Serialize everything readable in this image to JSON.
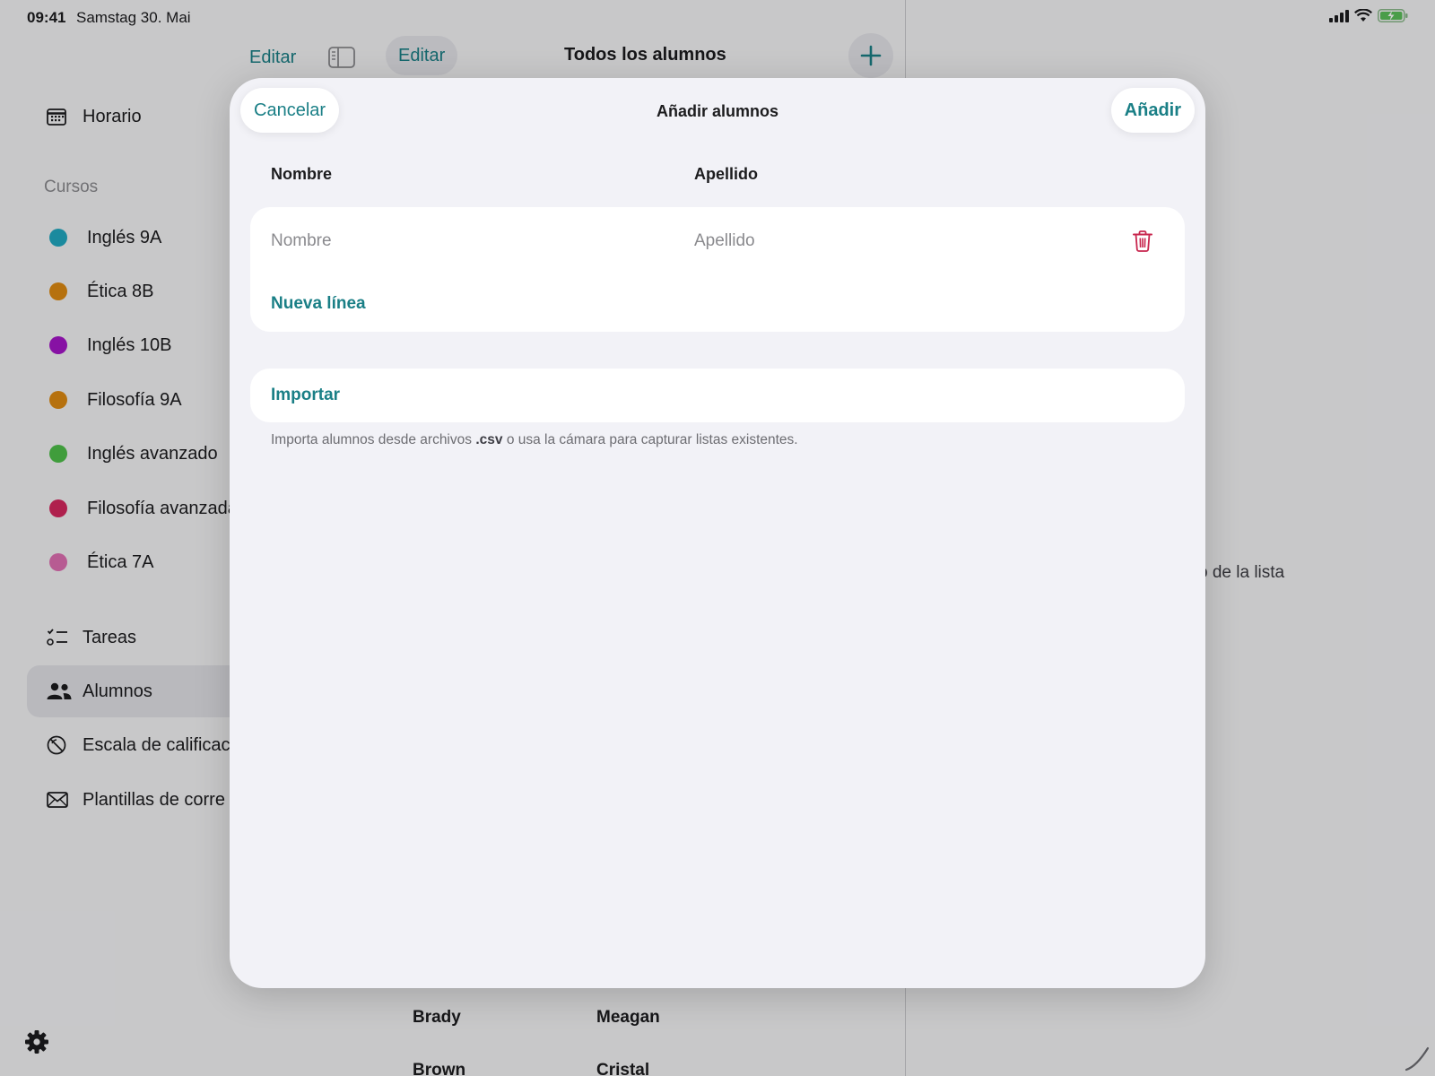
{
  "status_bar": {
    "time": "09:41",
    "date": "Samstag 30. Mai"
  },
  "sidebar": {
    "schedule": {
      "label": "Horario",
      "icon": "calendar-icon"
    },
    "courses_header": "Cursos",
    "courses": [
      {
        "label": "Inglés 9A",
        "color": "#22a9c1"
      },
      {
        "label": "Ética 8B",
        "color": "#df8a12"
      },
      {
        "label": "Inglés 10B",
        "color": "#a515c8"
      },
      {
        "label": "Filosofía 9A",
        "color": "#df8a12"
      },
      {
        "label": "Inglés avanzado",
        "color": "#4fc04a"
      },
      {
        "label": "Filosofía avanzada",
        "color": "#d6285f"
      },
      {
        "label": "Ética 7A",
        "color": "#e06fb3"
      }
    ],
    "tasks": {
      "label": "Tareas",
      "icon": "checklist-icon"
    },
    "students": {
      "label": "Alumnos",
      "icon": "people-icon",
      "selected": true
    },
    "grading": {
      "label": "Escala de calificac",
      "icon": "grade-scale-icon"
    },
    "email": {
      "label": "Plantillas de corre",
      "icon": "envelope-icon"
    },
    "settings_icon": "gear-icon"
  },
  "content": {
    "edit_left": "Editar",
    "edit_pill": "Editar",
    "title": "Todos los alumnos",
    "rows_visible": [
      {
        "first": "Brady",
        "last": "Meagan"
      },
      {
        "first": "Brown",
        "last": "Cristal"
      }
    ]
  },
  "detail": {
    "hint_fragment": "o de la lista"
  },
  "sheet": {
    "title": "Añadir alumnos",
    "cancel_label": "Cancelar",
    "add_label": "Añadir",
    "col_first": "Nombre",
    "col_last": "Apellido",
    "row": {
      "first_placeholder": "Nombre",
      "last_placeholder": "Apellido",
      "first_value": "",
      "last_value": ""
    },
    "new_line_label": "Nueva línea",
    "import_label": "Importar",
    "footnote_before": "Importa alumnos desde archivos",
    "footnote_ext": ".csv",
    "footnote_after": "o usa la cámara para capturar listas existentes."
  },
  "colors": {
    "accent": "#1a7f86",
    "destructive": "#c8264e"
  }
}
